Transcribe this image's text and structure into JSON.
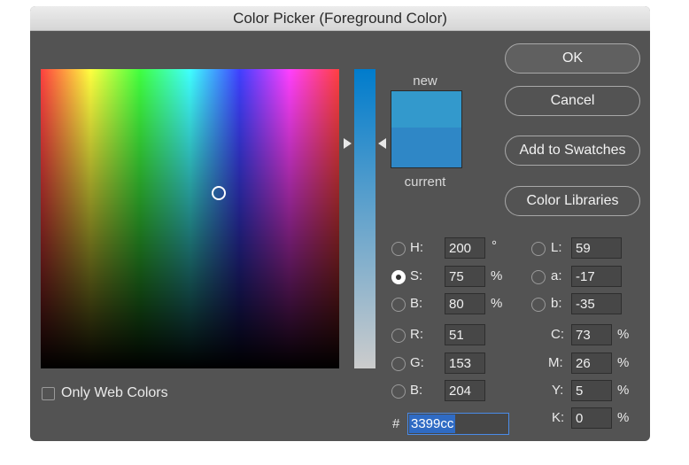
{
  "window": {
    "title": "Color Picker (Foreground Color)"
  },
  "swatch": {
    "new_label": "new",
    "current_label": "current",
    "new_color": "#3399cc",
    "current_color": "#2f87c6"
  },
  "buttons": {
    "ok": "OK",
    "cancel": "Cancel",
    "add_to_swatches": "Add to Swatches",
    "color_libraries": "Color Libraries"
  },
  "hsb": {
    "h": {
      "label": "H:",
      "value": "200",
      "unit": "°"
    },
    "s": {
      "label": "S:",
      "value": "75",
      "unit": "%"
    },
    "b": {
      "label": "B:",
      "value": "80",
      "unit": "%"
    }
  },
  "rgb": {
    "r": {
      "label": "R:",
      "value": "51"
    },
    "g": {
      "label": "G:",
      "value": "153"
    },
    "b": {
      "label": "B:",
      "value": "204"
    }
  },
  "lab": {
    "l": {
      "label": "L:",
      "value": "59"
    },
    "a": {
      "label": "a:",
      "value": "-17"
    },
    "b": {
      "label": "b:",
      "value": "-35"
    }
  },
  "cmyk": {
    "c": {
      "label": "C:",
      "value": "73",
      "unit": "%"
    },
    "m": {
      "label": "M:",
      "value": "26",
      "unit": "%"
    },
    "y": {
      "label": "Y:",
      "value": "5",
      "unit": "%"
    },
    "k": {
      "label": "K:",
      "value": "0",
      "unit": "%"
    }
  },
  "hex": {
    "label": "#",
    "value": "3399cc"
  },
  "only_web_colors": {
    "label": "Only Web Colors",
    "checked": false
  },
  "selected_channel": "S"
}
